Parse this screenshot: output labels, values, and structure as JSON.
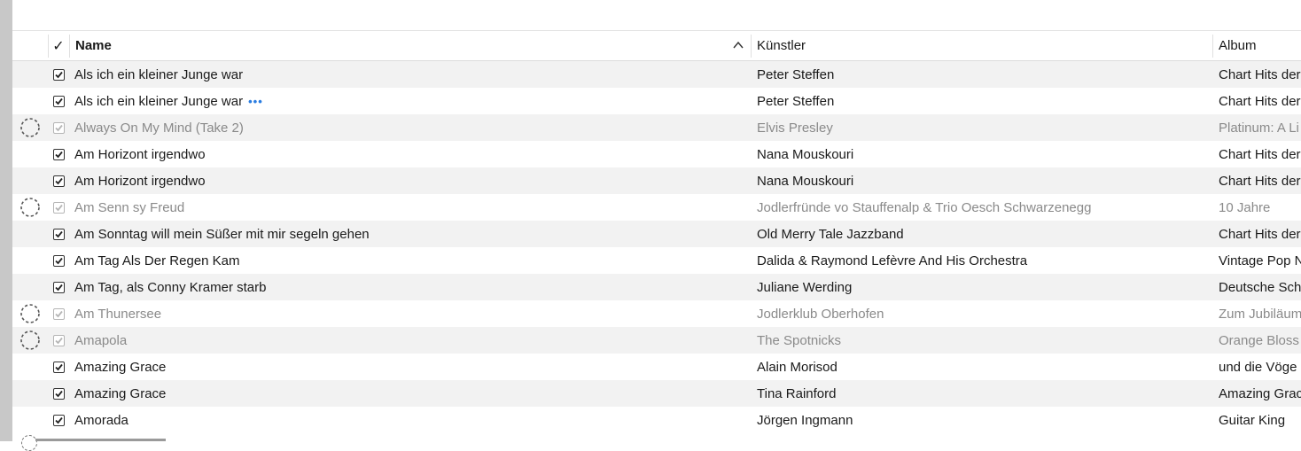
{
  "header": {
    "check_mark": "✓",
    "name_label": "Name",
    "artist_label": "Künstler",
    "album_label": "Album",
    "sort_icon": "chevron-up-icon"
  },
  "tracks": [
    {
      "name": "Als ich ein kleiner Junge war",
      "artist": "Peter Steffen",
      "album": "Chart Hits der",
      "checked": true,
      "cloud": false,
      "more": false
    },
    {
      "name": "Als ich ein kleiner Junge war",
      "artist": "Peter Steffen",
      "album": "Chart Hits der",
      "checked": true,
      "cloud": false,
      "more": true
    },
    {
      "name": "Always On My Mind (Take 2)",
      "artist": "Elvis Presley",
      "album": "Platinum: A Li",
      "checked": true,
      "cloud": true,
      "more": false
    },
    {
      "name": "Am Horizont irgendwo",
      "artist": "Nana Mouskouri",
      "album": "Chart Hits der",
      "checked": true,
      "cloud": false,
      "more": false
    },
    {
      "name": "Am Horizont irgendwo",
      "artist": "Nana Mouskouri",
      "album": "Chart Hits der",
      "checked": true,
      "cloud": false,
      "more": false
    },
    {
      "name": "Am Senn sy Freud",
      "artist": "Jodlerfründe vo Stauffenalp & Trio Oesch Schwarzenegg",
      "album": "10 Jahre",
      "checked": true,
      "cloud": true,
      "more": false
    },
    {
      "name": "Am Sonntag will mein Süßer mit mir segeln gehen",
      "artist": "Old Merry Tale Jazzband",
      "album": "Chart Hits der",
      "checked": true,
      "cloud": false,
      "more": false
    },
    {
      "name": "Am Tag Als Der Regen Kam",
      "artist": "Dalida & Raymond Lefèvre And His Orchestra",
      "album": "Vintage Pop N",
      "checked": true,
      "cloud": false,
      "more": false
    },
    {
      "name": "Am Tag, als Conny Kramer starb",
      "artist": "Juliane Werding",
      "album": "Deutsche Schl",
      "checked": true,
      "cloud": false,
      "more": false
    },
    {
      "name": "Am Thunersee",
      "artist": "Jodlerklub Oberhofen",
      "album": "Zum Jubiläum",
      "checked": true,
      "cloud": true,
      "more": false
    },
    {
      "name": "Amapola",
      "artist": "The Spotnicks",
      "album": "Orange Bloss",
      "checked": true,
      "cloud": true,
      "more": false
    },
    {
      "name": "Amazing Grace",
      "artist": "Alain Morisod",
      "album": "und die Vöge",
      "checked": true,
      "cloud": false,
      "more": false
    },
    {
      "name": "Amazing Grace",
      "artist": "Tina Rainford",
      "album": "Amazing Grac",
      "checked": true,
      "cloud": false,
      "more": false
    },
    {
      "name": "Amorada",
      "artist": "Jörgen Ingmann",
      "album": "Guitar King",
      "checked": true,
      "cloud": false,
      "more": false
    }
  ],
  "colors": {
    "more_dots": "#2a7de1",
    "dim_text": "#8a8a8a",
    "stripe": "#f2f2f2"
  }
}
